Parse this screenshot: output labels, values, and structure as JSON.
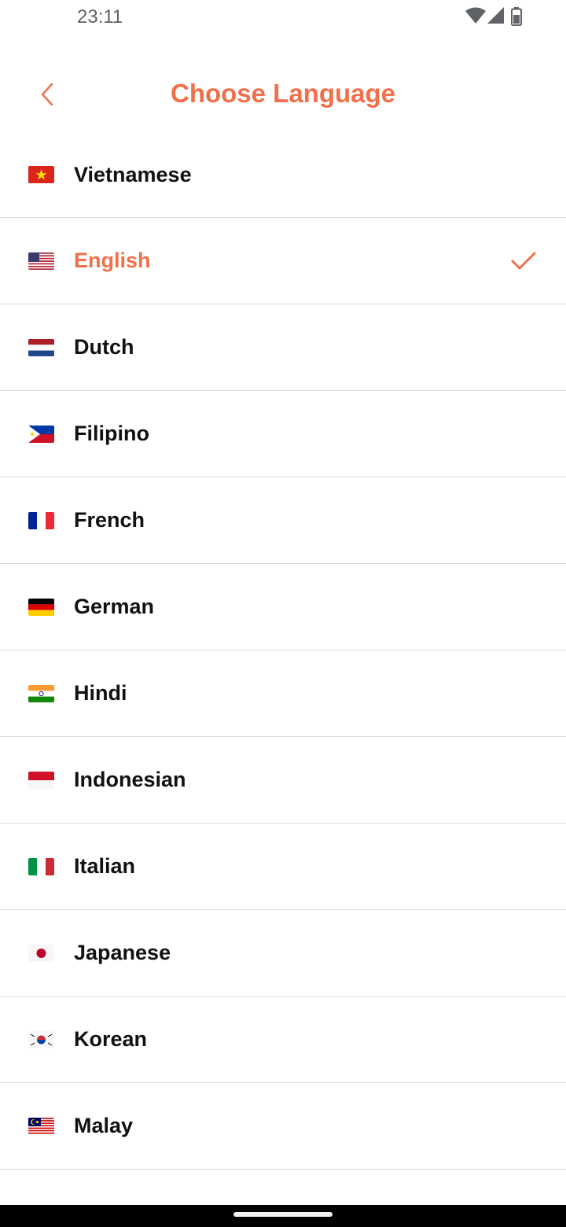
{
  "status_bar": {
    "time": "23:11",
    "icons": [
      "wifi-icon",
      "signal-icon",
      "battery-icon"
    ]
  },
  "header": {
    "title": "Choose Language",
    "back_icon": "chevron-left-icon"
  },
  "colors": {
    "accent": "#f26f4a",
    "text": "#111111",
    "divider": "#dcdcdc"
  },
  "languages": [
    {
      "label": "Vietnamese",
      "flag": "vn-flag",
      "selected": false
    },
    {
      "label": "English",
      "flag": "us-flag",
      "selected": true
    },
    {
      "label": "Dutch",
      "flag": "nl-flag",
      "selected": false
    },
    {
      "label": "Filipino",
      "flag": "ph-flag",
      "selected": false
    },
    {
      "label": "French",
      "flag": "fr-flag",
      "selected": false
    },
    {
      "label": "German",
      "flag": "de-flag",
      "selected": false
    },
    {
      "label": "Hindi",
      "flag": "in-flag",
      "selected": false
    },
    {
      "label": "Indonesian",
      "flag": "id-flag",
      "selected": false
    },
    {
      "label": "Italian",
      "flag": "it-flag",
      "selected": false
    },
    {
      "label": "Japanese",
      "flag": "jp-flag",
      "selected": false
    },
    {
      "label": "Korean",
      "flag": "kr-flag",
      "selected": false
    },
    {
      "label": "Malay",
      "flag": "my-flag",
      "selected": false
    }
  ]
}
